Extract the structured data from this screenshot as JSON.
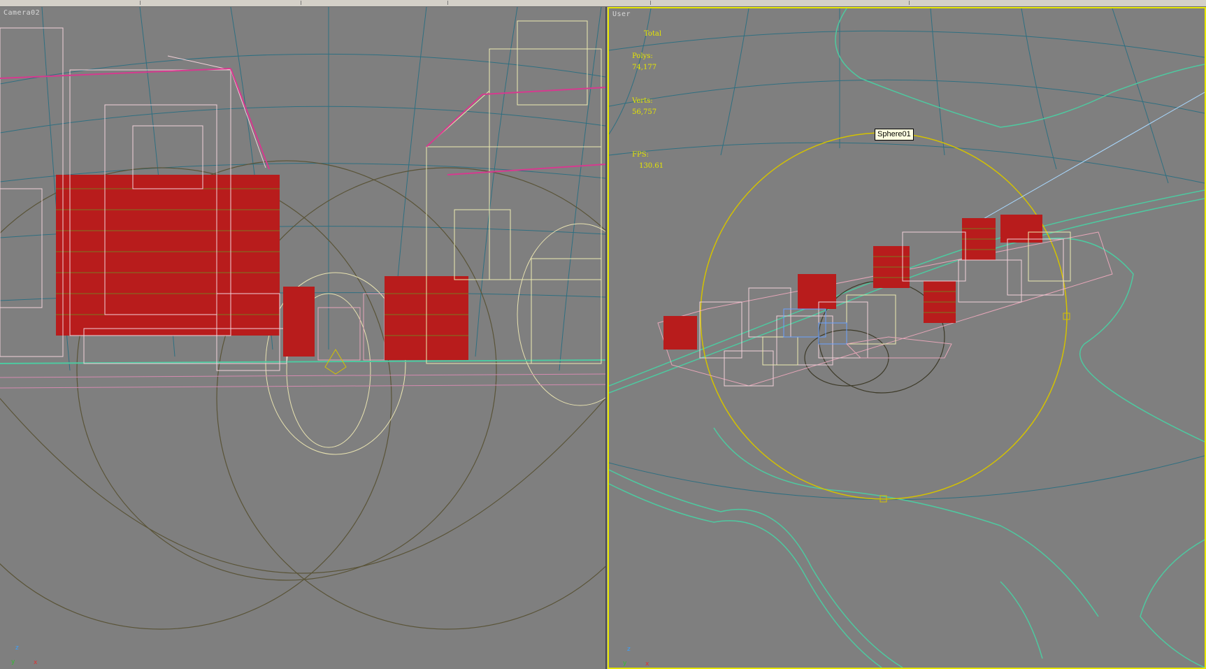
{
  "viewports": {
    "left": {
      "label": "Camera02"
    },
    "right": {
      "label": "User",
      "stats": {
        "total_label": "Total",
        "polys_label": "Polys:",
        "polys_value": "74,177",
        "verts_label": "Verts:",
        "verts_value": "56,757",
        "fps_label": "FPS:",
        "fps_value": "130.61"
      },
      "tooltip": "Sphere01"
    }
  },
  "axis_tripod": {
    "z": "z",
    "y": "y",
    "x": "x"
  },
  "colors": {
    "viewport_bg": "#7f7f7f",
    "active_border": "#e6e600",
    "grid": "#2f6f80",
    "building_red": "#b81c1c",
    "wire_pink": "#e6a6b8",
    "wire_cream": "#ecebb0",
    "terrain": "#4ec9a0",
    "sphere": "#d4c200"
  }
}
